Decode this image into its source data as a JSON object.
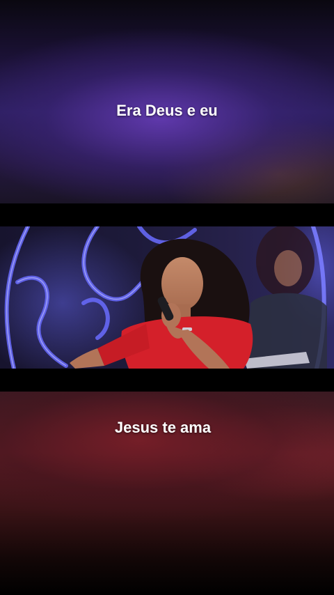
{
  "captions": {
    "top": "Era Deus e eu",
    "bottom": "Jesus te ama"
  },
  "colors": {
    "caption_text": "#ffffff",
    "letterbox": "#000000",
    "top_tint": "#2b1f5e",
    "bottom_tint": "#5a1c24",
    "stage_light": "#5a5cf0",
    "singer_dress": "#d4202a"
  },
  "video": {
    "scene": "singer-performing-with-microphone"
  }
}
